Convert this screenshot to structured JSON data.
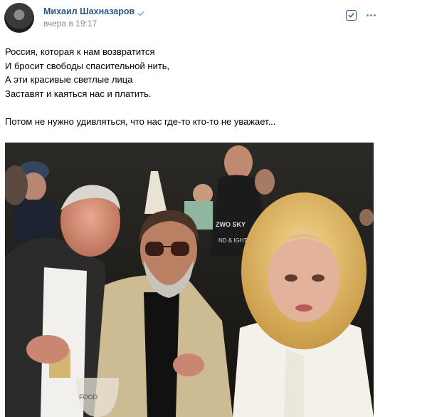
{
  "post": {
    "author": {
      "name": "Михаил Шахназаров",
      "verified_icon": "verified-check-icon"
    },
    "timestamp": "вчера в 19:17",
    "actions": {
      "follow_icon": "checkbox-check-icon",
      "more_icon": "more-dots-icon"
    },
    "text_lines": [
      "Россия, которая к нам возвратится",
      "И бросит свободы спасительной нить,",
      "А эти красивые светлые лица",
      "Заставят и каяться нас и платить."
    ],
    "text_paragraph": "Потом не нужно удивляться, что нас где-то кто-то не уважает...",
    "photo": {
      "shirt_print": [
        "ZWO SKY",
        "ND & IGHT"
      ],
      "glass_print": "FOOD"
    }
  },
  "colors": {
    "author_link": "#2a5885",
    "timestamp": "#818c99",
    "background": "#ffffff"
  }
}
